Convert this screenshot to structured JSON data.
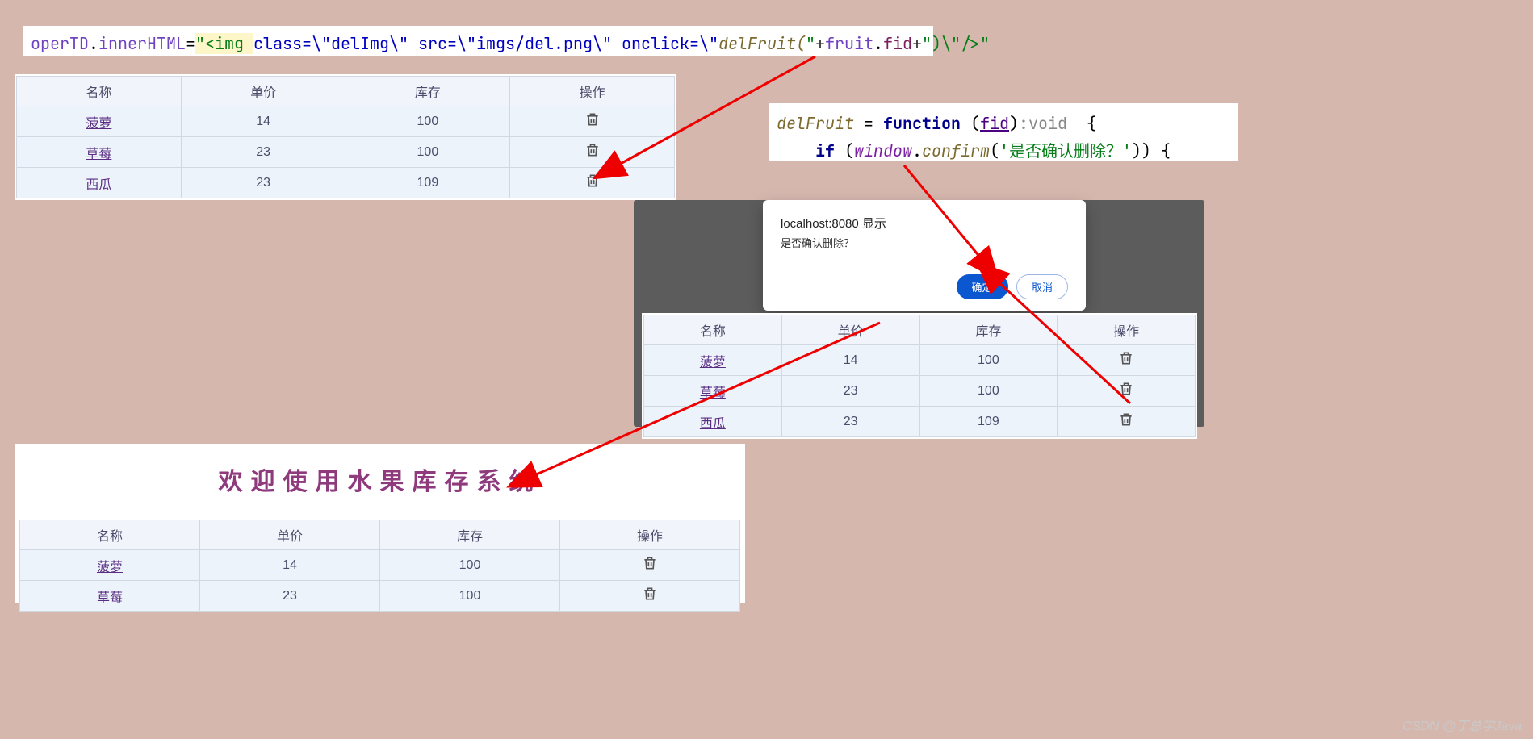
{
  "code1_parts": {
    "a": "operTD",
    "b": ".",
    "c": "innerHTML",
    "d": "=",
    "e": "\"<img ",
    "f": "class=\\\"delImg\\\" ",
    "g": "src=\\\"imgs/del.png\\\" ",
    "h": "onclick=\\\"",
    "i": "delFruit(",
    "j": "\"",
    "k": "+",
    "l": "fruit",
    "m": ".",
    "n": "fid",
    "o": "+",
    "p": "\"",
    "q": ")\\\"/>\""
  },
  "code2_parts": {
    "a": "delFruit",
    "b": " = ",
    "c": "function",
    "d": " (",
    "e": "fid",
    "f": ")",
    "g": ":void",
    "h": "  {",
    "i": "    if",
    "j": " (",
    "k": "window",
    "l": ".",
    "m": "confirm",
    "n": "(",
    "o": "'是否确认删除？'",
    "p": ")) {"
  },
  "table_headers": {
    "name": "名称",
    "price": "单价",
    "stock": "库存",
    "oper": "操作"
  },
  "table1_rows": [
    {
      "name": "菠萝",
      "price": "14",
      "stock": "100"
    },
    {
      "name": "草莓",
      "price": "23",
      "stock": "100"
    },
    {
      "name": "西瓜",
      "price": "23",
      "stock": "109"
    }
  ],
  "dialog": {
    "host": "localhost:8080 显示",
    "msg": "是否确认删除？",
    "ok": "确定",
    "cancel": "取消"
  },
  "table2_rows": [
    {
      "name": "菠萝",
      "price": "14",
      "stock": "100"
    },
    {
      "name": "草莓",
      "price": "23",
      "stock": "100"
    },
    {
      "name": "西瓜",
      "price": "23",
      "stock": "109"
    }
  ],
  "lower_title": "欢迎使用水果库存系统",
  "table3_rows": [
    {
      "name": "菠萝",
      "price": "14",
      "stock": "100"
    },
    {
      "name": "草莓",
      "price": "23",
      "stock": "100"
    }
  ],
  "watermark": "CSDN @丁总学Java"
}
